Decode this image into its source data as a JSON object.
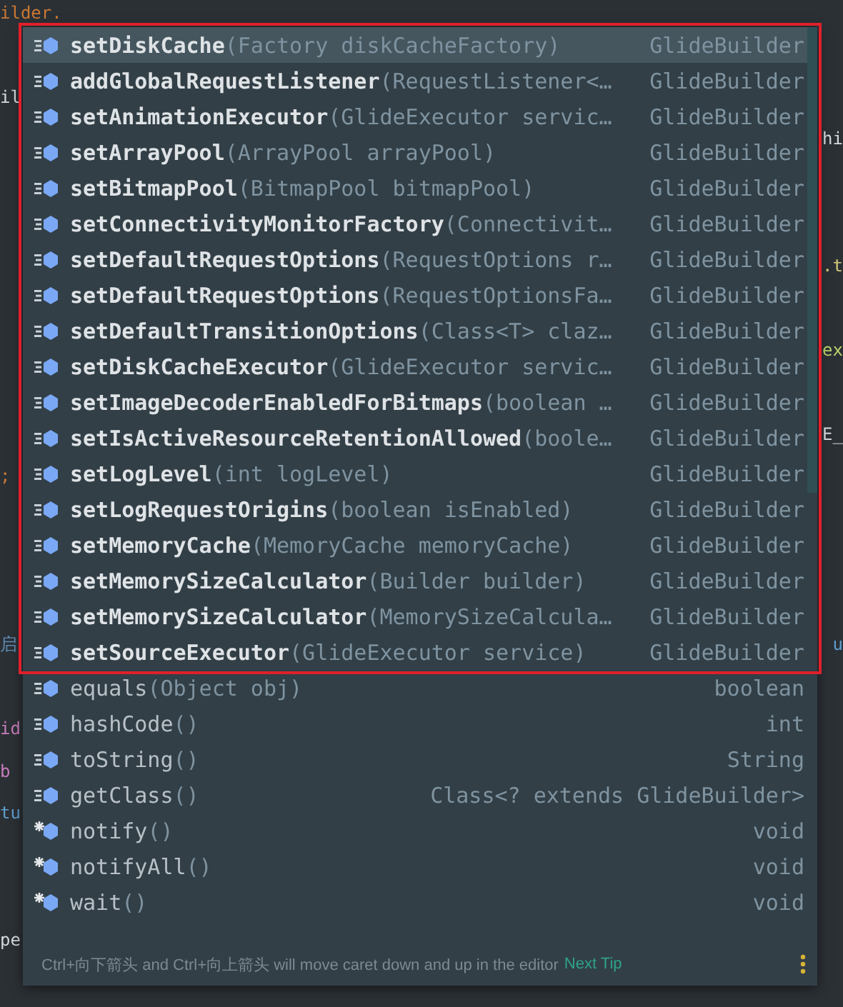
{
  "editor_lines": [
    {
      "text": "ilder.",
      "color": "#cc7832"
    },
    {
      "text": "il",
      "color": "#d5d9dc"
    },
    {
      "text": ";",
      "color": "#cc7832"
    },
    {
      "text": "启",
      "color": "#5f8bb0"
    },
    {
      "text": "id",
      "color": "#c77dbb"
    },
    {
      "text": "b",
      "color": "#c77dbb"
    },
    {
      "text": "tu",
      "color": "#5f9fd0"
    },
    {
      "text": "pe",
      "color": "#d5d9dc"
    }
  ],
  "editor_right_fragments": [
    {
      "text": "hi",
      "color": "#d5d9dc"
    },
    {
      "text": ".t",
      "color": "#d7c97a"
    },
    {
      "text": "ex",
      "color": "#b8d36a"
    },
    {
      "text": "E_",
      "color": "#d5d9dc"
    },
    {
      "text": "u",
      "color": "#5f9fd0"
    }
  ],
  "completion_popup": {
    "groups": [
      {
        "highlighted": true,
        "bold": true,
        "items": [
          {
            "kind": "method",
            "name": "setDiskCache",
            "signature": "(Factory diskCacheFactory)",
            "type": "GlideBuilder",
            "selected": true
          },
          {
            "kind": "method",
            "name": "addGlobalRequestListener",
            "signature": "(RequestListener<…",
            "type": "GlideBuilder",
            "selected": false
          },
          {
            "kind": "method",
            "name": "setAnimationExecutor",
            "signature": "(GlideExecutor servic…",
            "type": "GlideBuilder",
            "selected": false
          },
          {
            "kind": "method",
            "name": "setArrayPool",
            "signature": "(ArrayPool arrayPool)",
            "type": "GlideBuilder",
            "selected": false
          },
          {
            "kind": "method",
            "name": "setBitmapPool",
            "signature": "(BitmapPool bitmapPool)",
            "type": "GlideBuilder",
            "selected": false
          },
          {
            "kind": "method",
            "name": "setConnectivityMonitorFactory",
            "signature": "(Connectivit…",
            "type": "GlideBuilder",
            "selected": false
          },
          {
            "kind": "method",
            "name": "setDefaultRequestOptions",
            "signature": "(RequestOptions r…",
            "type": "GlideBuilder",
            "selected": false
          },
          {
            "kind": "method",
            "name": "setDefaultRequestOptions",
            "signature": "(RequestOptionsFa…",
            "type": "GlideBuilder",
            "selected": false
          },
          {
            "kind": "method",
            "name": "setDefaultTransitionOptions",
            "signature": "(Class<T> claz…",
            "type": "GlideBuilder",
            "selected": false
          },
          {
            "kind": "method",
            "name": "setDiskCacheExecutor",
            "signature": "(GlideExecutor servic…",
            "type": "GlideBuilder",
            "selected": false
          },
          {
            "kind": "method",
            "name": "setImageDecoderEnabledForBitmaps",
            "signature": "(boolean …",
            "type": "GlideBuilder",
            "selected": false
          },
          {
            "kind": "method",
            "name": "setIsActiveResourceRetentionAllowed",
            "signature": "(boole…",
            "type": "GlideBuilder",
            "selected": false
          },
          {
            "kind": "method",
            "name": "setLogLevel",
            "signature": "(int logLevel)",
            "type": "GlideBuilder",
            "selected": false
          },
          {
            "kind": "method",
            "name": "setLogRequestOrigins",
            "signature": "(boolean isEnabled)",
            "type": "GlideBuilder",
            "selected": false
          },
          {
            "kind": "method",
            "name": "setMemoryCache",
            "signature": "(MemoryCache memoryCache)",
            "type": "GlideBuilder",
            "selected": false
          },
          {
            "kind": "method",
            "name": "setMemorySizeCalculator",
            "signature": "(Builder builder)",
            "type": "GlideBuilder",
            "selected": false
          },
          {
            "kind": "method",
            "name": "setMemorySizeCalculator",
            "signature": "(MemorySizeCalcula…",
            "type": "GlideBuilder",
            "selected": false
          },
          {
            "kind": "method",
            "name": "setSourceExecutor",
            "signature": "(GlideExecutor service)",
            "type": "GlideBuilder",
            "selected": false
          }
        ]
      },
      {
        "highlighted": false,
        "bold": false,
        "items": [
          {
            "kind": "method",
            "name": "equals",
            "signature": "(Object obj)",
            "type": "boolean",
            "selected": false
          },
          {
            "kind": "method",
            "name": "hashCode",
            "signature": "()",
            "type": "int",
            "selected": false
          },
          {
            "kind": "method",
            "name": "toString",
            "signature": "()",
            "type": "String",
            "selected": false
          },
          {
            "kind": "method",
            "name": "getClass",
            "signature": "()",
            "type": "Class<? extends GlideBuilder>",
            "selected": false
          },
          {
            "kind": "native",
            "name": "notify",
            "signature": "()",
            "type": "void",
            "selected": false
          },
          {
            "kind": "native",
            "name": "notifyAll",
            "signature": "()",
            "type": "void",
            "selected": false
          },
          {
            "kind": "native",
            "name": "wait",
            "signature": "()",
            "type": "void",
            "selected": false
          }
        ]
      }
    ],
    "footer": {
      "hint": "Ctrl+向下箭头 and Ctrl+向上箭头 will move caret down and up in the editor",
      "link": "Next Tip"
    }
  }
}
